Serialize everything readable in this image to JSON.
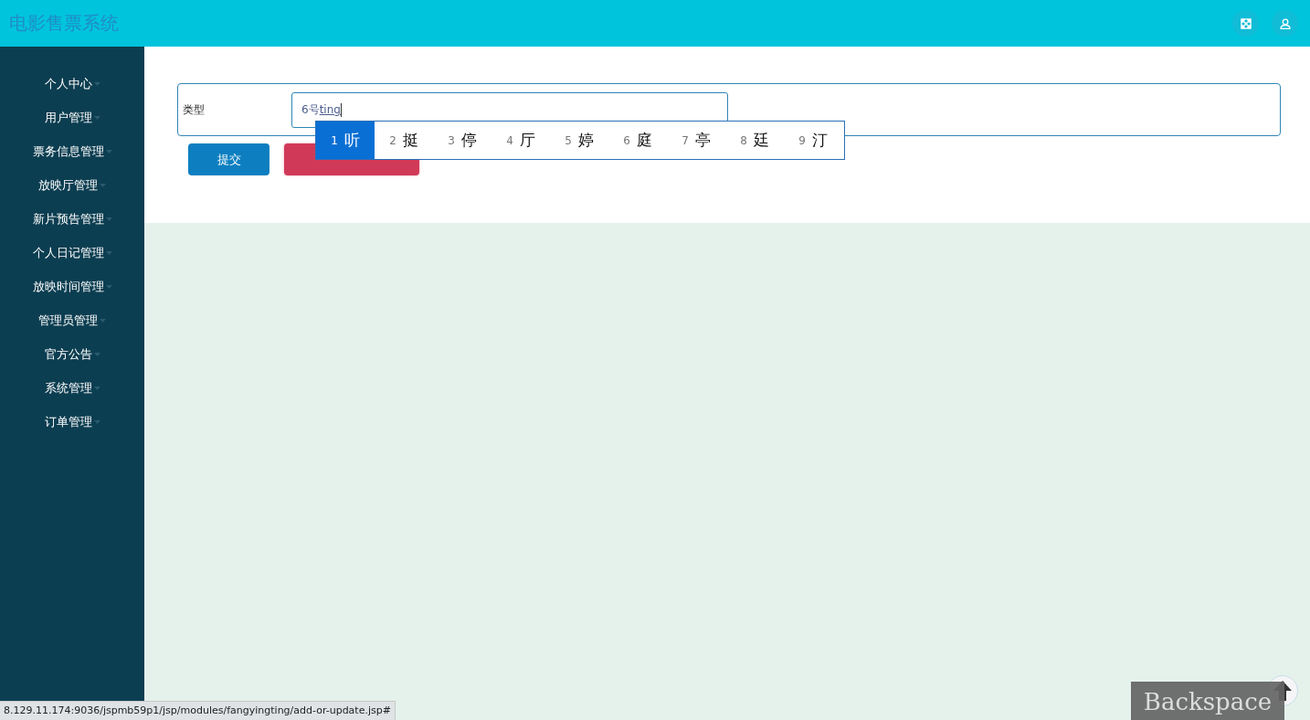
{
  "header": {
    "title": "电影售票系统",
    "buttons": [
      {
        "kind": "fullscreen"
      },
      {
        "kind": "user"
      }
    ]
  },
  "sidebar": {
    "items": [
      {
        "label": "个人中心"
      },
      {
        "label": "用户管理"
      },
      {
        "label": "票务信息管理"
      },
      {
        "label": "放映厅管理"
      },
      {
        "label": "新片预告管理"
      },
      {
        "label": "个人日记管理"
      },
      {
        "label": "放映时间管理"
      },
      {
        "label": "管理员管理"
      },
      {
        "label": "官方公告"
      },
      {
        "label": "系统管理"
      },
      {
        "label": "订单管理"
      }
    ]
  },
  "form": {
    "fields": [
      {
        "label": "类型",
        "value": "6号",
        "composition": "ting"
      }
    ],
    "buttons": [
      {
        "kind": "submit",
        "label": "提交"
      },
      {
        "kind": "cancel"
      }
    ]
  },
  "ime": {
    "candidates": [
      {
        "number": "1",
        "text": "听",
        "selected": true
      },
      {
        "number": "2",
        "text": "挺",
        "selected": false
      },
      {
        "number": "3",
        "text": "停",
        "selected": false
      },
      {
        "number": "4",
        "text": "厅",
        "selected": false
      },
      {
        "number": "5",
        "text": "婷",
        "selected": false
      },
      {
        "number": "6",
        "text": "庭",
        "selected": false
      },
      {
        "number": "7",
        "text": "亭",
        "selected": false
      },
      {
        "number": "8",
        "text": "廷",
        "selected": false
      },
      {
        "number": "9",
        "text": "汀",
        "selected": false
      }
    ]
  },
  "status_bar": {
    "url": "8.129.11.174:9036/jspmb59p1/jsp/modules/fangyingting/add-or-update.jsp#"
  },
  "key_overlay": {
    "key": "Backspace"
  }
}
